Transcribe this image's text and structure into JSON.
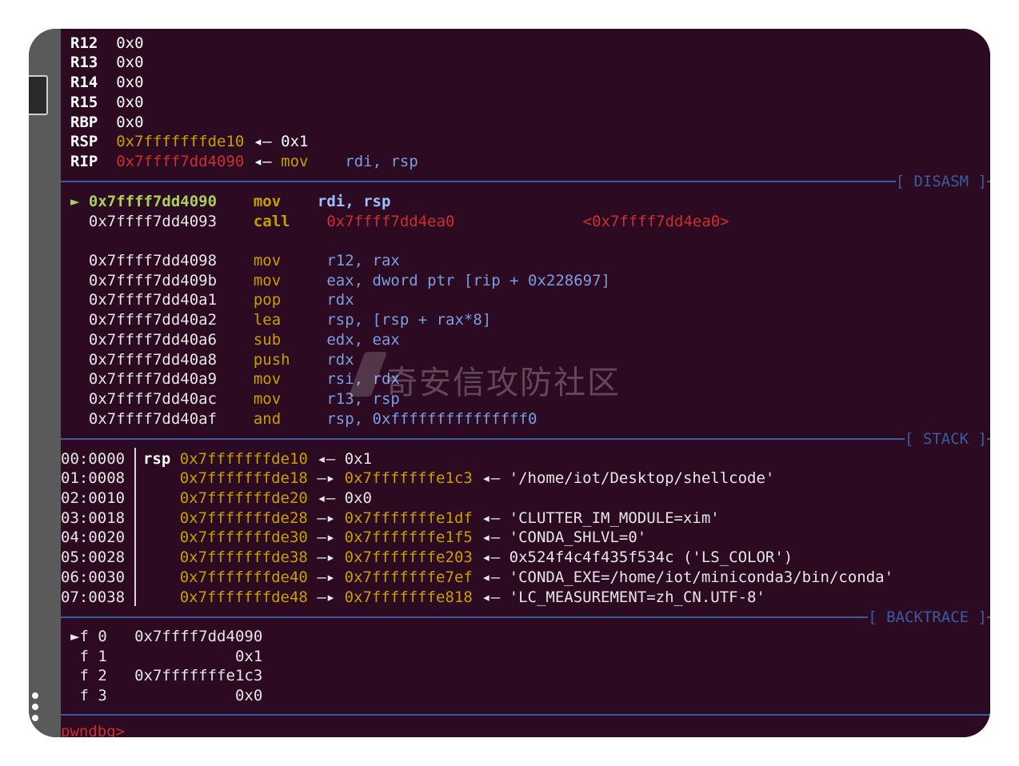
{
  "registers": [
    {
      "name": "R12",
      "value": "0x0"
    },
    {
      "name": "R13",
      "value": "0x0"
    },
    {
      "name": "R14",
      "value": "0x0"
    },
    {
      "name": "R15",
      "value": "0x0"
    },
    {
      "name": "RBP",
      "value": "0x0"
    },
    {
      "name": "RSP",
      "value": "0x7fffffffde10",
      "arrow": "◂—",
      "target": "0x1"
    },
    {
      "name": "RIP",
      "value": "0x7ffff7dd4090",
      "arrow": "◂—",
      "target_op": "mov",
      "target_args": "rdi, rsp"
    }
  ],
  "sections": {
    "disasm": "[ DISASM ]",
    "stack": "[ STACK ]",
    "backtrace": "[ BACKTRACE ]"
  },
  "disasm": [
    {
      "marker": "►",
      "addr": "0x7ffff7dd4090",
      "op": "mov",
      "args": "rdi, rsp"
    },
    {
      "marker": "",
      "addr": "0x7ffff7dd4093",
      "op": "call",
      "args": "0x7ffff7dd4ea0",
      "comment": "<0x7ffff7dd4ea0>"
    },
    {
      "marker": "",
      "addr": "0x7ffff7dd4098",
      "op": "mov",
      "args": "r12, rax"
    },
    {
      "marker": "",
      "addr": "0x7ffff7dd409b",
      "op": "mov",
      "args": "eax, dword ptr [rip + 0x228697]"
    },
    {
      "marker": "",
      "addr": "0x7ffff7dd40a1",
      "op": "pop",
      "args": "rdx"
    },
    {
      "marker": "",
      "addr": "0x7ffff7dd40a2",
      "op": "lea",
      "args": "rsp, [rsp + rax*8]"
    },
    {
      "marker": "",
      "addr": "0x7ffff7dd40a6",
      "op": "sub",
      "args": "edx, eax"
    },
    {
      "marker": "",
      "addr": "0x7ffff7dd40a8",
      "op": "push",
      "args": "rdx"
    },
    {
      "marker": "",
      "addr": "0x7ffff7dd40a9",
      "op": "mov",
      "args": "rsi, rdx"
    },
    {
      "marker": "",
      "addr": "0x7ffff7dd40ac",
      "op": "mov",
      "args": "r13, rsp"
    },
    {
      "marker": "",
      "addr": "0x7ffff7dd40af",
      "op": "and",
      "args": "rsp, 0xfffffffffffffff0"
    }
  ],
  "stack": [
    {
      "idx": "00:0000",
      "reg": "rsp",
      "addr": "0x7fffffffde10",
      "arrow": "◂—",
      "val": "0x1"
    },
    {
      "idx": "01:0008",
      "reg": "",
      "addr": "0x7fffffffde18",
      "arrow": "—▸",
      "val": "0x7fffffffe1c3",
      "arrow2": "◂—",
      "str": "'/home/iot/Desktop/shellcode'"
    },
    {
      "idx": "02:0010",
      "reg": "",
      "addr": "0x7fffffffde20",
      "arrow": "◂—",
      "val": "0x0"
    },
    {
      "idx": "03:0018",
      "reg": "",
      "addr": "0x7fffffffde28",
      "arrow": "—▸",
      "val": "0x7fffffffe1df",
      "arrow2": "◂—",
      "str": "'CLUTTER_IM_MODULE=xim'"
    },
    {
      "idx": "04:0020",
      "reg": "",
      "addr": "0x7fffffffde30",
      "arrow": "—▸",
      "val": "0x7fffffffe1f5",
      "arrow2": "◂—",
      "str": "'CONDA_SHLVL=0'"
    },
    {
      "idx": "05:0028",
      "reg": "",
      "addr": "0x7fffffffde38",
      "arrow": "—▸",
      "val": "0x7fffffffe203",
      "arrow2": "◂—",
      "str": "0x524f4c4f435f534c ('LS_COLOR')"
    },
    {
      "idx": "06:0030",
      "reg": "",
      "addr": "0x7fffffffde40",
      "arrow": "—▸",
      "val": "0x7fffffffe7ef",
      "arrow2": "◂—",
      "str": "'CONDA_EXE=/home/iot/miniconda3/bin/conda'"
    },
    {
      "idx": "07:0038",
      "reg": "",
      "addr": "0x7fffffffde48",
      "arrow": "—▸",
      "val": "0x7fffffffe818",
      "arrow2": "◂—",
      "str": "'LC_MEASUREMENT=zh_CN.UTF-8'"
    }
  ],
  "backtrace": [
    {
      "marker": "►",
      "frame": "f 0",
      "addr": "0x7ffff7dd4090"
    },
    {
      "marker": "",
      "frame": "f 1",
      "addr": "0x1"
    },
    {
      "marker": "",
      "frame": "f 2",
      "addr": "0x7fffffffe1c3"
    },
    {
      "marker": "",
      "frame": "f 3",
      "addr": "0x0"
    }
  ],
  "prompt": "pwndbg>",
  "watermark": "奇安信攻防社区",
  "colors": {
    "background": "#2c0a22",
    "yellow": "#c4a000",
    "red": "#cc2f2f",
    "blue": "#7a9ee0",
    "separator": "#3a5da0"
  }
}
